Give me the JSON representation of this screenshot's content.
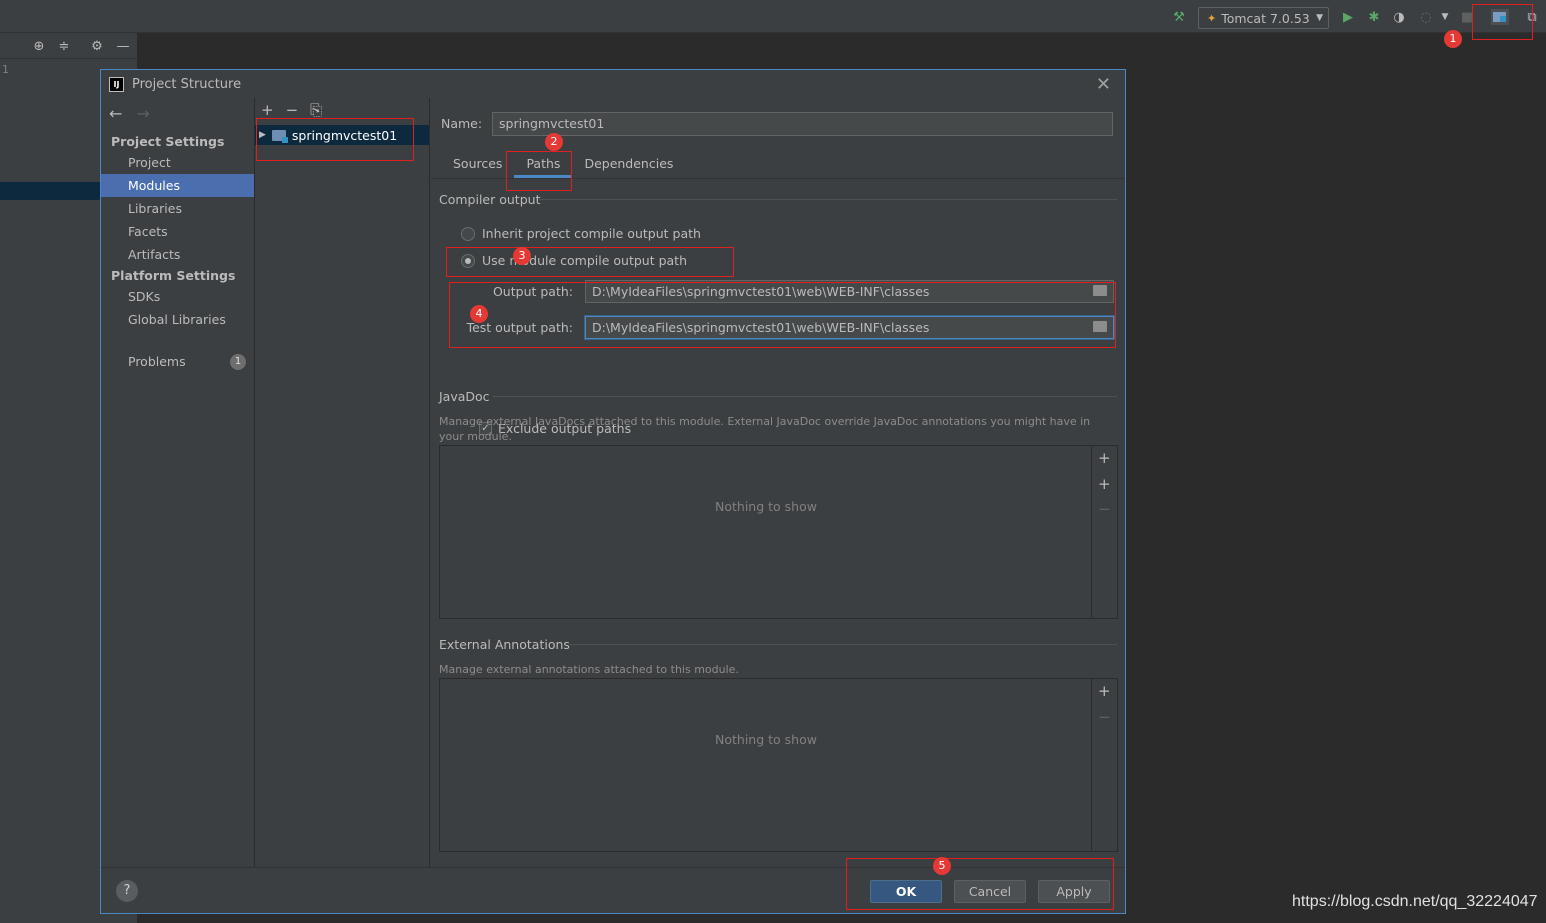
{
  "ide": {
    "line_number": "1",
    "run_config": "Tomcat 7.0.53"
  },
  "dialog": {
    "title": "Project Structure",
    "logo": "IJ"
  },
  "nav": {
    "project_settings_header": "Project Settings",
    "items_project": [
      "Project",
      "Modules",
      "Libraries",
      "Facets",
      "Artifacts"
    ],
    "platform_settings_header": "Platform Settings",
    "items_platform": [
      "SDKs",
      "Global Libraries"
    ],
    "problems_label": "Problems",
    "problems_count": "1",
    "selected": "Modules"
  },
  "tree": {
    "module_name": "springmvctest01"
  },
  "content": {
    "name_label": "Name:",
    "name_value": "springmvctest01",
    "tabs": [
      "Sources",
      "Paths",
      "Dependencies"
    ],
    "active_tab": "Paths",
    "compiler_output_title": "Compiler output",
    "radio_inherit": "Inherit project compile output path",
    "radio_use_module": "Use module compile output path",
    "output_path_label": "Output path:",
    "output_path_value": "D:\\MyIdeaFiles\\springmvctest01\\web\\WEB-INF\\classes",
    "test_output_path_label": "Test output path:",
    "test_output_path_value": "D:\\MyIdeaFiles\\springmvctest01\\web\\WEB-INF\\classes",
    "exclude_label": "Exclude output paths",
    "exclude_checked": true,
    "javadoc_title": "JavaDoc",
    "javadoc_desc": "Manage external JavaDocs attached to this module. External JavaDoc override JavaDoc annotations you might have in your module.",
    "javadoc_empty": "Nothing to show",
    "ext_annotations_title": "External Annotations",
    "ext_annotations_desc": "Manage external annotations attached to this module.",
    "ext_annotations_empty": "Nothing to show"
  },
  "footer": {
    "help": "?",
    "ok": "OK",
    "cancel": "Cancel",
    "apply": "Apply"
  },
  "annotations": [
    "1",
    "2",
    "3",
    "4",
    "5"
  ],
  "watermark": "https://blog.csdn.net/qq_32224047",
  "colors": {
    "accent": "#4a88c7",
    "selection": "#4b6eaf",
    "annotation_red": "#e53935"
  }
}
